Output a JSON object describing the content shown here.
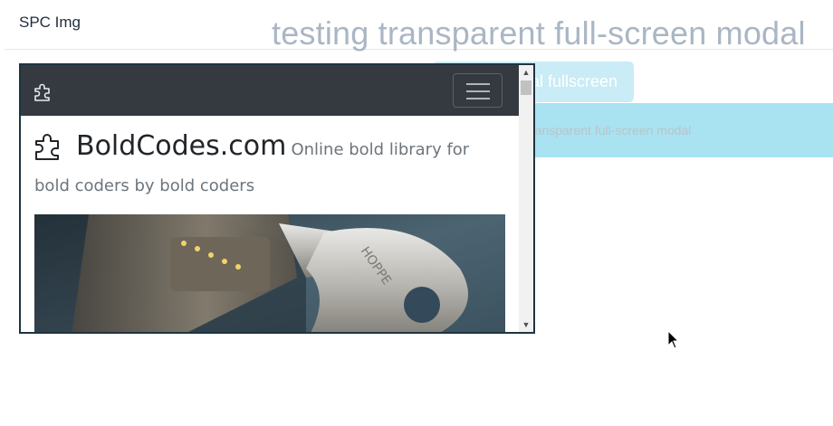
{
  "page": {
    "brand": "SPC Img",
    "heading": "testing transparent full-screen modal",
    "open_button_label": "al fullscreen",
    "info_text": "ransparent full-screen modal"
  },
  "modal": {
    "navbar_logo_icon": "puzzle-piece-icon",
    "toggler_icon": "hamburger-menu-icon",
    "site_name": "BoldCodes.com",
    "tagline": "Online bold library for bold coders by bold coders",
    "hero_image": "key-in-lock-photo"
  },
  "colors": {
    "navbar": "#343a40",
    "info_bar": "#a9e2f0",
    "button": "#c9ecf6",
    "heading": "#aab6c4"
  }
}
